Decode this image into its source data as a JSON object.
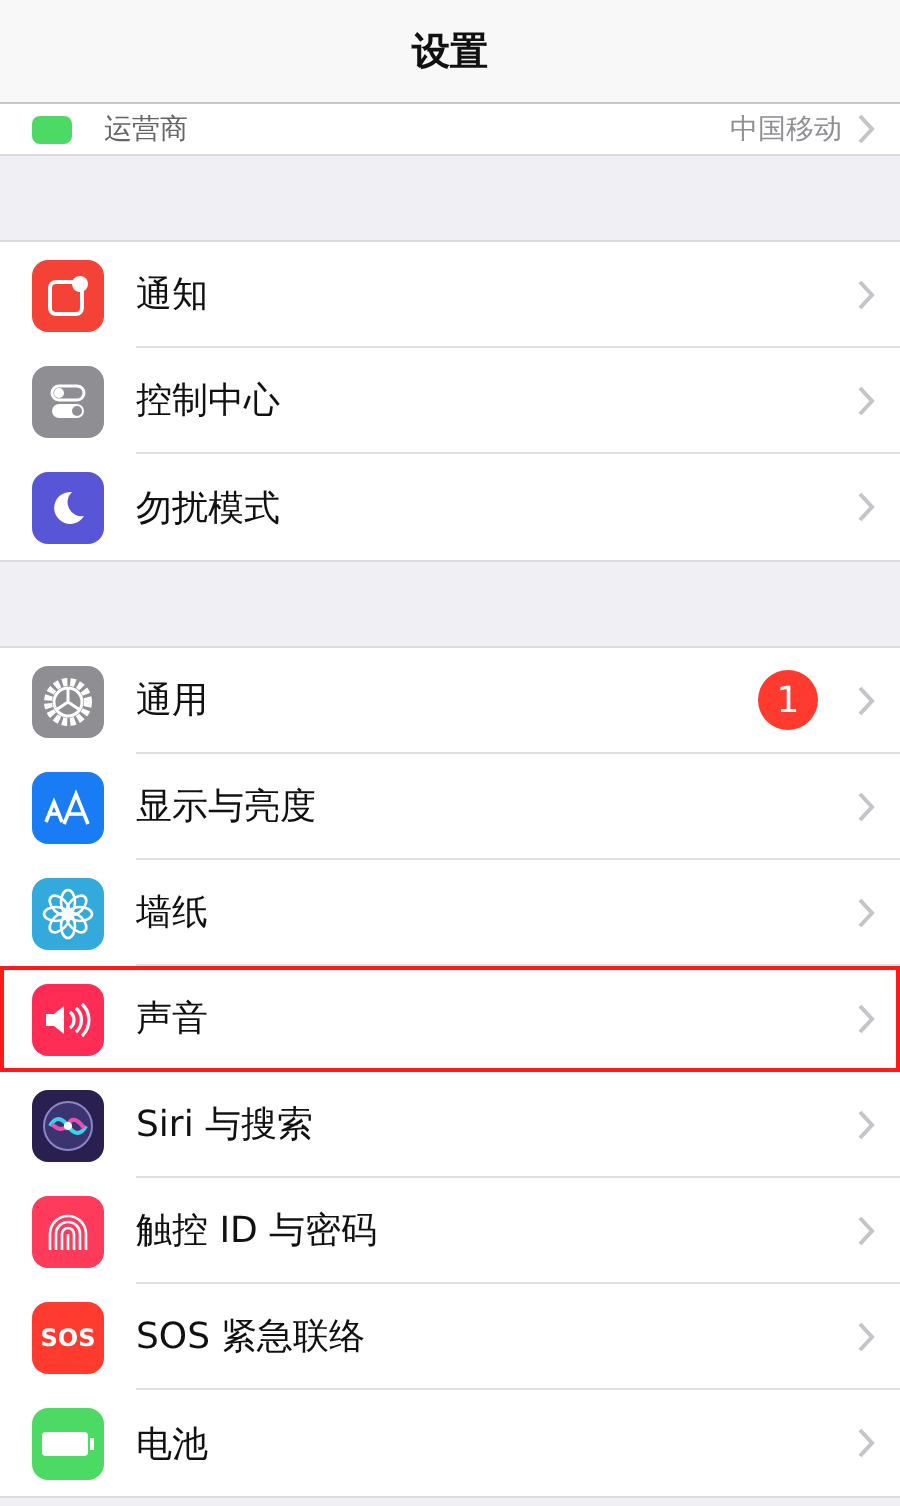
{
  "nav_bar": {
    "title": "设置"
  },
  "carrier_row": {
    "label": "运营商",
    "value": "中国移动"
  },
  "groups": [
    {
      "items": [
        {
          "kind": "notifications",
          "label": "通知",
          "color": "#f44336",
          "highlighted": false
        },
        {
          "kind": "control",
          "label": "控制中心",
          "color": "#8e8e93",
          "highlighted": false
        },
        {
          "kind": "moon",
          "label": "勿扰模式",
          "color": "#5856d6",
          "highlighted": false
        }
      ]
    },
    {
      "items": [
        {
          "kind": "gear",
          "label": "通用",
          "color": "#8e8e93",
          "badge": "1",
          "highlighted": false
        },
        {
          "kind": "text",
          "label": "显示与亮度",
          "color": "#1a7cf5",
          "highlighted": false
        },
        {
          "kind": "flower",
          "label": "墙纸",
          "color": "#34aadc",
          "highlighted": false
        },
        {
          "kind": "speaker",
          "label": "声音",
          "color": "#ff2d55",
          "highlighted": true
        },
        {
          "kind": "siri",
          "label": "Siri 与搜索",
          "color": "#2a2050",
          "highlighted": false
        },
        {
          "kind": "fingerprint",
          "label": "触控 ID 与密码",
          "color": "#ff3b5c",
          "highlighted": false
        },
        {
          "kind": "sos",
          "label": "SOS 紧急联络",
          "color": "#ff3b30",
          "icon_text": "SOS",
          "highlighted": false
        },
        {
          "kind": "battery",
          "label": "电池",
          "color": "#4cd964",
          "highlighted": false
        }
      ]
    }
  ]
}
